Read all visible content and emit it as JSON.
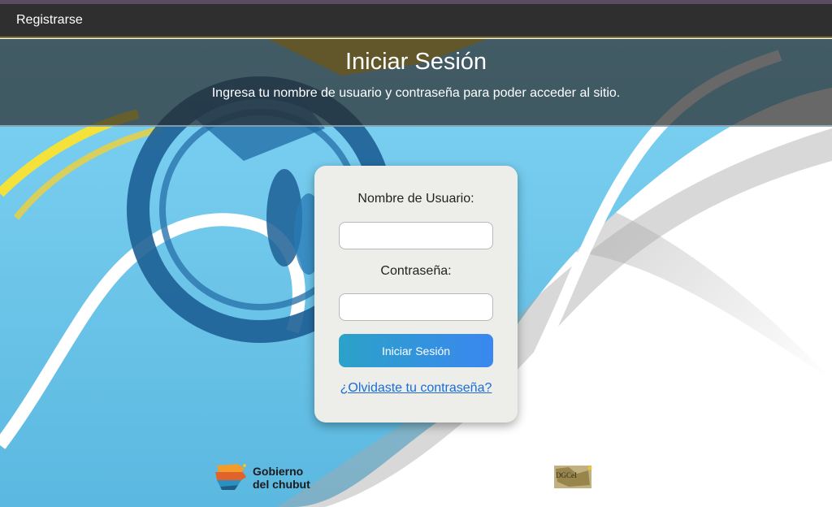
{
  "navbar": {
    "register_label": "Registrarse"
  },
  "hero": {
    "title": "Iniciar Sesión",
    "subtitle": "Ingresa tu nombre de usuario y contraseña para poder acceder al sitio."
  },
  "login_form": {
    "username_label": "Nombre de Usuario:",
    "username_value": "",
    "password_label": "Contraseña:",
    "password_value": "",
    "submit_label": "Iniciar Sesión",
    "forgot_link": "¿Olvidaste tu contraseña?"
  },
  "footer": {
    "logo_gobierno": {
      "line1": "Gobierno",
      "line2": "del chubut"
    },
    "logo_dgcei": {
      "text": "DGCeI"
    }
  },
  "colors": {
    "navbar_bg": "#2f2f2f",
    "flag_blue": "#6ccbef",
    "emblem_blue": "#1d5f95",
    "sun_yellow": "#f2c319",
    "card_bg": "#ededea",
    "button_start": "#2ba2c8",
    "button_end": "#3a87f0",
    "link_blue": "#1a6cd6"
  }
}
